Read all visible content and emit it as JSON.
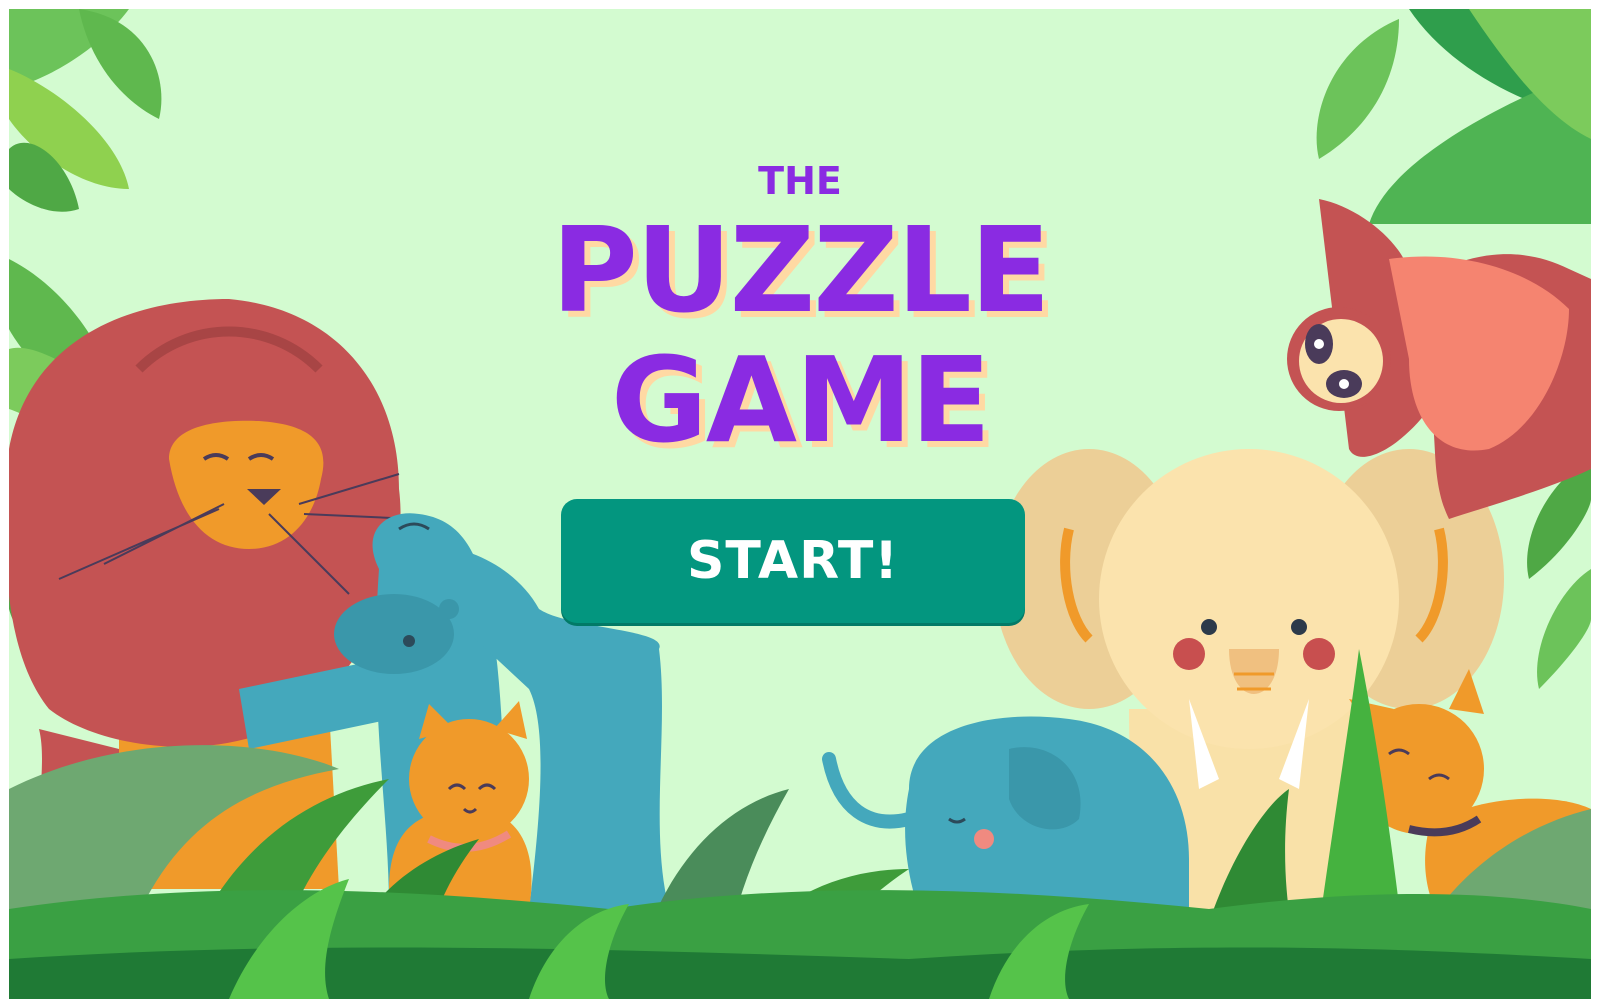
{
  "title": {
    "small": "THE",
    "line1": "PUZZLE",
    "line2": "GAME"
  },
  "start_button": {
    "label": "START!"
  },
  "colors": {
    "background": "#d3fbd0",
    "title": "#8a2be2",
    "title_shadow": "#ffd9a3",
    "button": "#03967f",
    "button_text": "#ffffff"
  },
  "characters": [
    "lion",
    "hippo",
    "cat",
    "baby-elephant",
    "elephant",
    "sloth",
    "cat"
  ]
}
